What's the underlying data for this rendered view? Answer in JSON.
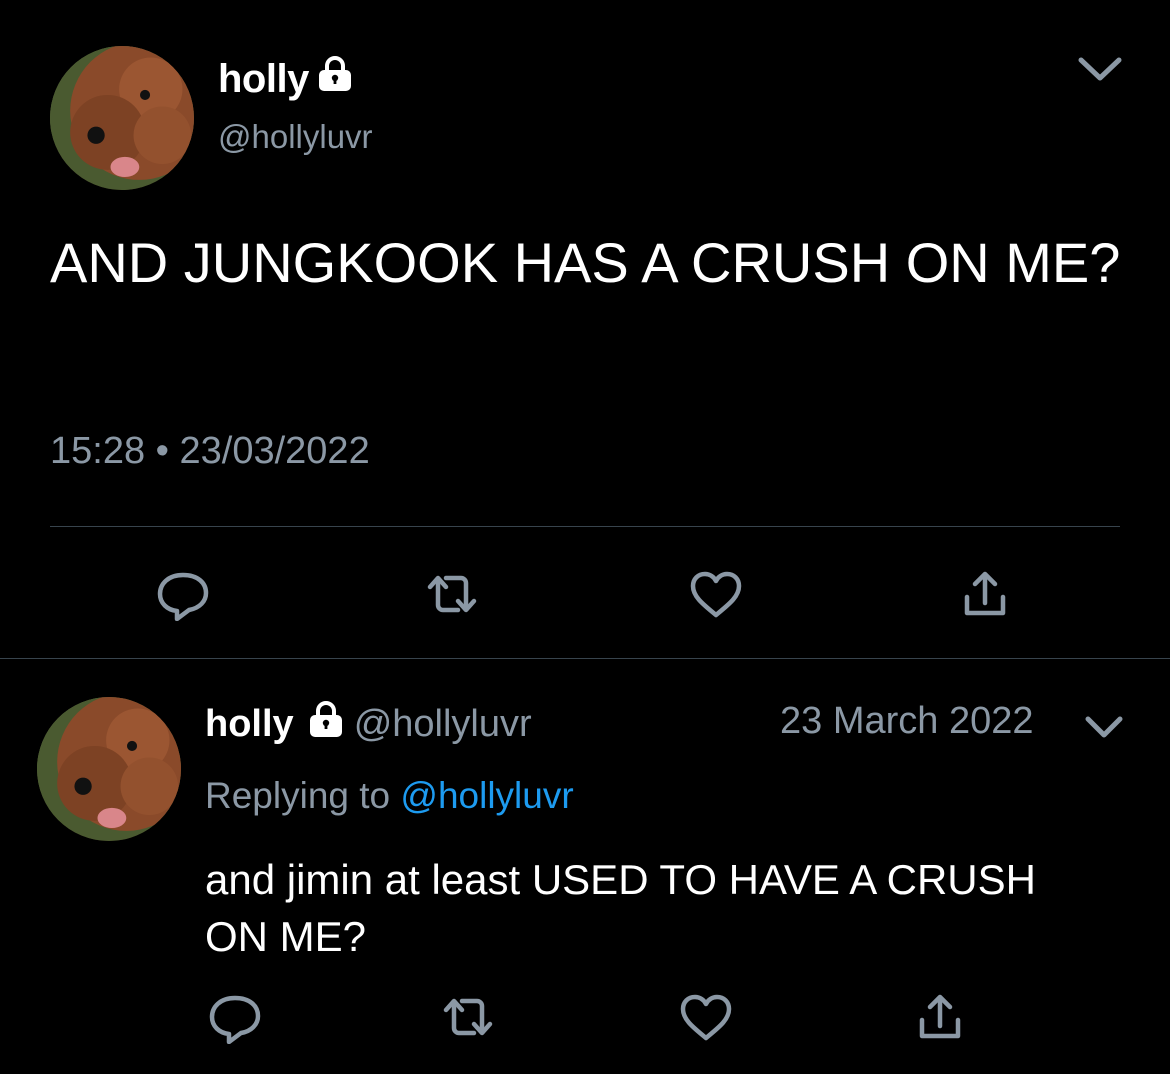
{
  "main_tweet": {
    "display_name": "holly",
    "handle": "@hollyluvr",
    "text": "AND JUNGKOOK HAS A CRUSH ON ME?",
    "timestamp": "15:28 • 23/03/2022",
    "avatar_icon": "poodle-avatar",
    "protected_icon": "lock-icon",
    "menu_icon": "chevron-down-icon"
  },
  "reply_tweet": {
    "display_name": "holly",
    "handle": "@hollyluvr",
    "date": "23 March 2022",
    "replying_prefix": "Replying to",
    "replying_to": "@hollyluvr",
    "text": "and jimin at least USED TO HAVE A CRUSH ON ME?",
    "avatar_icon": "poodle-avatar",
    "protected_icon": "lock-icon",
    "menu_icon": "chevron-down-icon"
  },
  "actions": [
    "reply-icon",
    "retweet-icon",
    "like-icon",
    "share-icon"
  ],
  "colors": {
    "background": "#000000",
    "primary_text": "#ffffff",
    "secondary_text": "#8b98a5",
    "link": "#1d9bf0",
    "divider": "#38444d"
  }
}
